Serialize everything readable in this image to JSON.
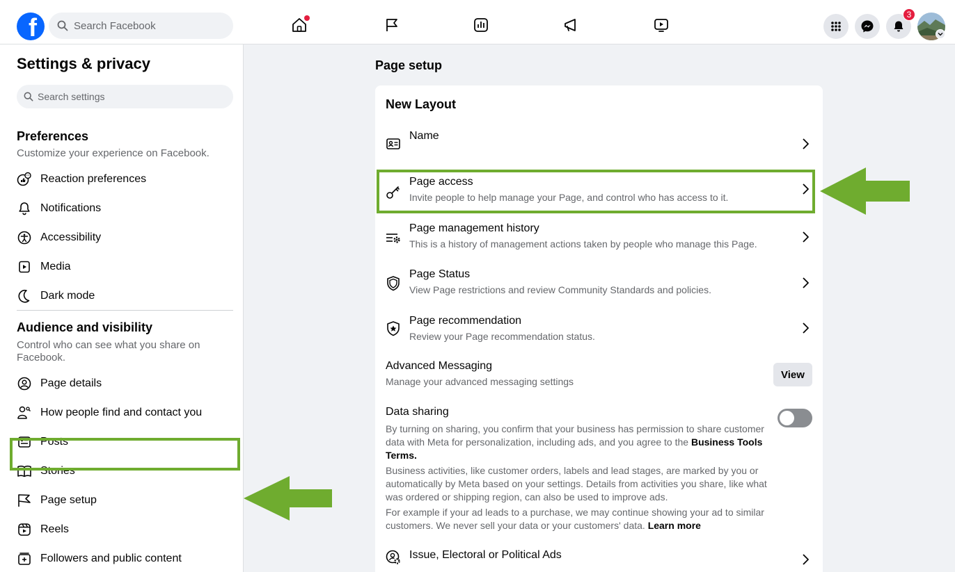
{
  "topbar": {
    "logo": "f",
    "search_placeholder": "Search Facebook",
    "nav_icons": [
      "home-icon",
      "flag-icon",
      "insights-icon",
      "megaphone-icon",
      "video-icon"
    ],
    "notification_count": "3"
  },
  "sidebar": {
    "title": "Settings & privacy",
    "search_placeholder": "Search settings",
    "preferences": {
      "title": "Preferences",
      "subtitle": "Customize your experience on Facebook.",
      "items": [
        {
          "label": "Reaction preferences",
          "icon": "reaction-icon"
        },
        {
          "label": "Notifications",
          "icon": "bell-icon"
        },
        {
          "label": "Accessibility",
          "icon": "accessibility-icon"
        },
        {
          "label": "Media",
          "icon": "media-icon"
        },
        {
          "label": "Dark mode",
          "icon": "moon-icon"
        }
      ]
    },
    "audience": {
      "title": "Audience and visibility",
      "subtitle": "Control who can see what you share on Facebook.",
      "items": [
        {
          "label": "Page details",
          "icon": "person-circle-icon"
        },
        {
          "label": "How people find and contact you",
          "icon": "person-search-icon"
        },
        {
          "label": "Posts",
          "icon": "posts-icon"
        },
        {
          "label": "Stories",
          "icon": "book-icon"
        },
        {
          "label": "Page setup",
          "icon": "flag-icon"
        },
        {
          "label": "Reels",
          "icon": "reels-icon"
        },
        {
          "label": "Followers and public content",
          "icon": "followers-icon"
        }
      ]
    }
  },
  "main": {
    "title": "Page setup",
    "card_title": "New Layout",
    "rows": [
      {
        "title": "Name",
        "subtitle": "",
        "icon": "id-card-icon"
      },
      {
        "title": "Page access",
        "subtitle": "Invite people to help manage your Page, and control who has access to it.",
        "icon": "key-icon"
      },
      {
        "title": "Page management history",
        "subtitle": "This is a history of management actions taken by people who manage this Page.",
        "icon": "history-gear-icon"
      },
      {
        "title": "Page Status",
        "subtitle": "View Page restrictions and review Community Standards and policies.",
        "icon": "shield-icon"
      },
      {
        "title": "Page recommendation",
        "subtitle": "Review your Page recommendation status.",
        "icon": "star-shield-icon"
      }
    ],
    "advanced_messaging": {
      "title": "Advanced Messaging",
      "subtitle": "Manage your advanced messaging settings",
      "button": "View"
    },
    "data_sharing": {
      "title": "Data sharing",
      "p1": "By turning on sharing, you confirm that your business has permission to share customer data with Meta for personalization, including ads, and you agree to the",
      "p1_bold": "Business Tools Terms.",
      "p2": "Business activities, like customer orders, labels and lead stages, are marked by you or automatically by Meta based on your settings. Details from activities you share, like what was ordered or shipping region, can also be used to improve ads.",
      "p3": "For example if your ad leads to a purchase, we may continue showing your ad to similar customers. We never sell your data or your customers' data.",
      "p3_link": "Learn more",
      "toggle_on": false
    },
    "last_row": {
      "title": "Issue, Electoral or Political Ads",
      "icon": "political-ads-icon"
    }
  },
  "colors": {
    "highlight": "#6fac2f",
    "brand": "#0866ff",
    "badge": "#e41e3f"
  }
}
